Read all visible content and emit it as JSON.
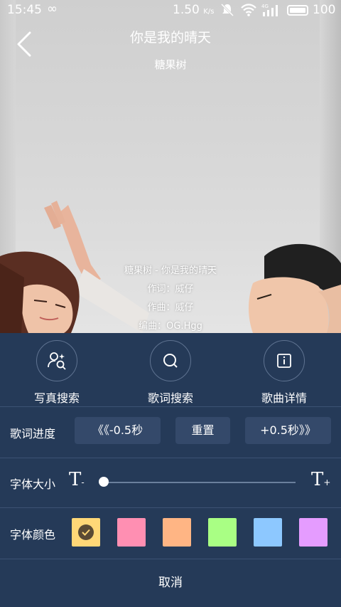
{
  "status": {
    "time": "15:45",
    "speed": "1.50",
    "speed_unit": "K/s",
    "network": "4G",
    "battery": "100"
  },
  "header": {
    "title": "你是我的晴天",
    "artist": "糖果树"
  },
  "lyrics": [
    "糖果树 - 你是我的晴天",
    "作词：威仔",
    "作曲：威仔",
    "编曲：OG.Hgg"
  ],
  "actions": [
    {
      "label": "写真搜索",
      "icon": "photo-search-icon"
    },
    {
      "label": "歌词搜索",
      "icon": "search-icon"
    },
    {
      "label": "歌曲详情",
      "icon": "info-icon"
    }
  ],
  "progress": {
    "label": "歌词进度",
    "minus": "《《-0.5秒",
    "reset": "重置",
    "plus": "+0.5秒》》"
  },
  "font_size": {
    "label": "字体大小",
    "value_fraction": 0.0
  },
  "font_color": {
    "label": "字体颜色",
    "colors": [
      "#ffd777",
      "#ff8fb2",
      "#ffb584",
      "#a9ff84",
      "#8dc8ff",
      "#e59cff"
    ],
    "selected": 0
  },
  "cancel": "取消"
}
